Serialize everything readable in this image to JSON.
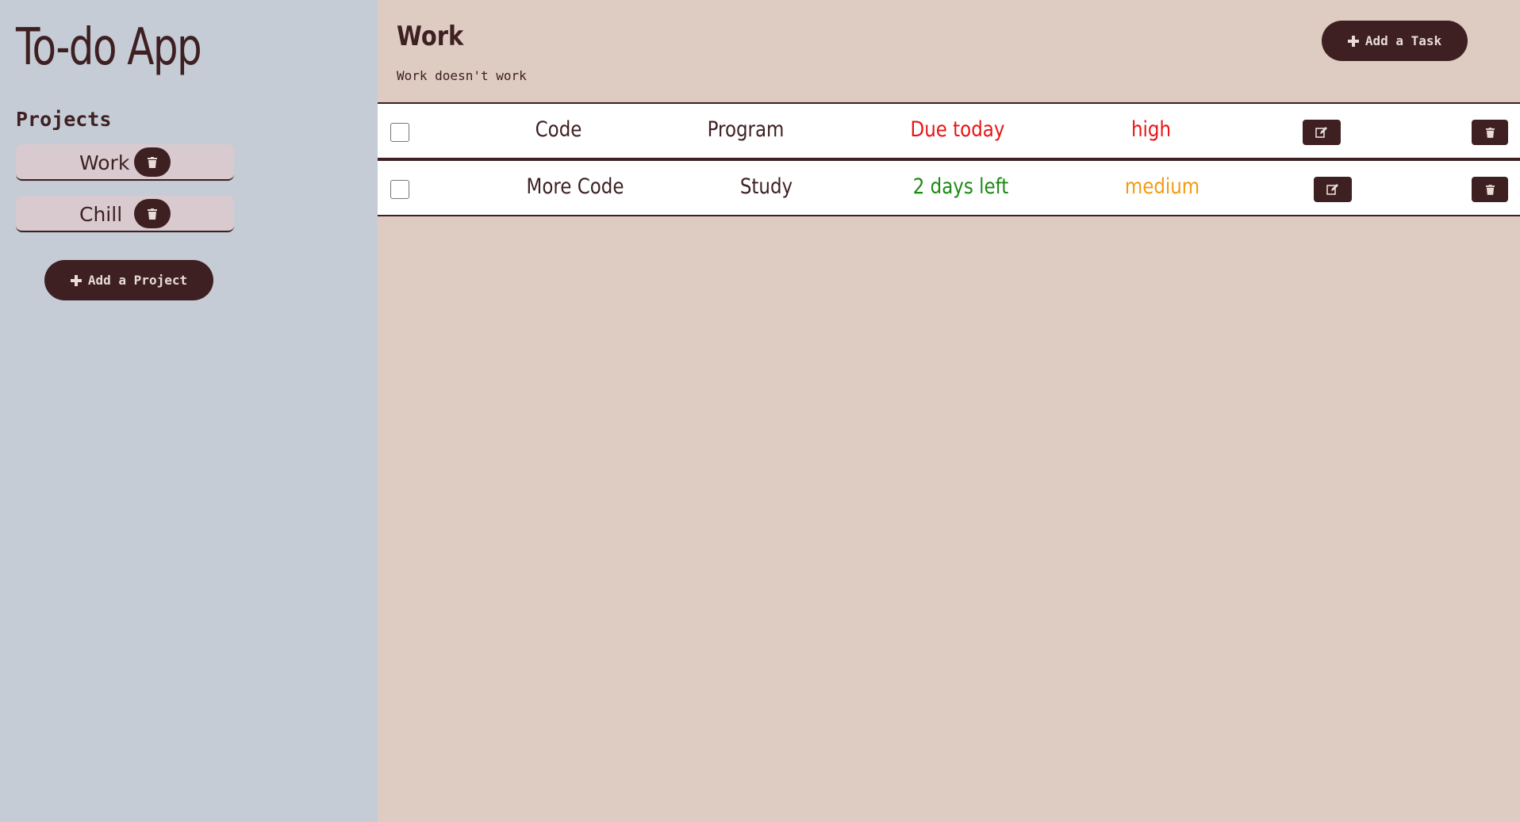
{
  "sidebar": {
    "app_title": "To-do App",
    "projects_heading": "Projects",
    "projects": [
      {
        "name": "Work"
      },
      {
        "name": "Chill"
      }
    ],
    "add_project_label": "Add a Project"
  },
  "main": {
    "project_title": "Work",
    "project_description": "Work doesn't work",
    "add_task_label": "Add a Task",
    "tasks": [
      {
        "title": "Code",
        "description": "Program",
        "due": "Due today",
        "due_color": "#e81414",
        "priority": "high",
        "priority_color": "#e81414"
      },
      {
        "title": "More Code",
        "description": "Study",
        "due": "2 days left",
        "due_color": "#1b8a12",
        "priority": "medium",
        "priority_color": "#f39c12"
      }
    ]
  },
  "colors": {
    "accent": "#3e2022",
    "sidebar_bg": "#c5ccd6",
    "main_bg": "#decbc1",
    "project_item_bg": "#d8cacf"
  },
  "icons": {
    "plus": "plus-icon",
    "trash": "trash-icon",
    "edit": "edit-icon"
  }
}
